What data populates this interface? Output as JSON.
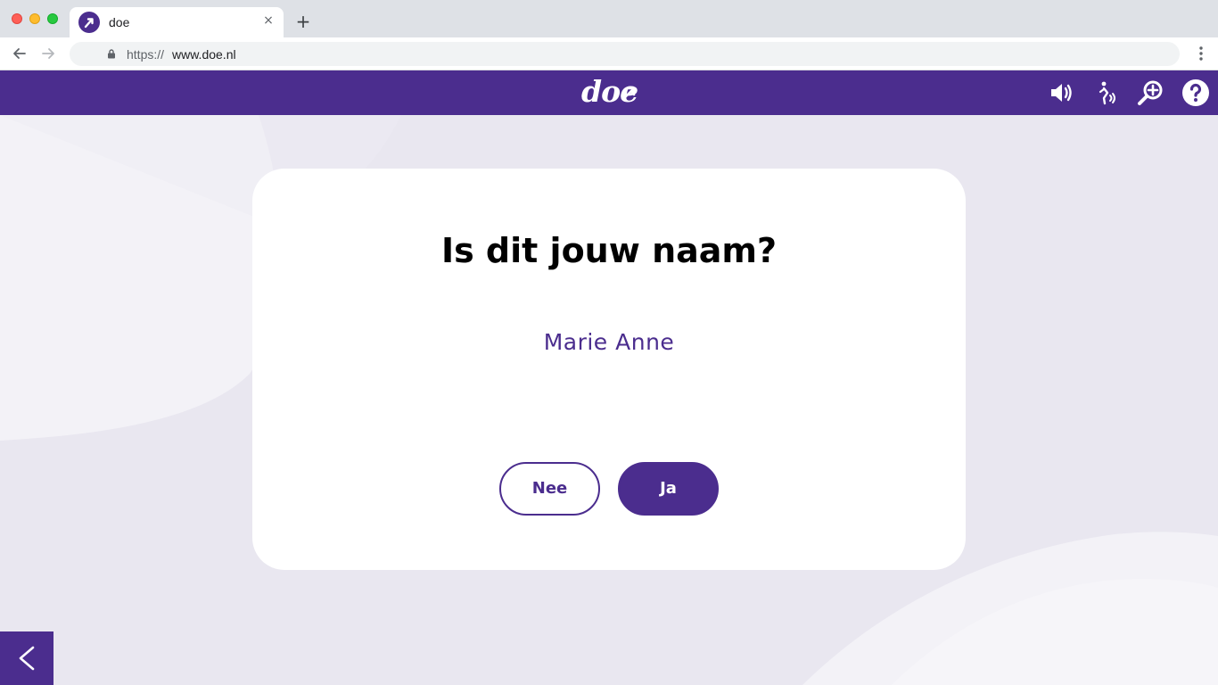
{
  "browser": {
    "tab_title": "doe",
    "new_tab_symbol": "+",
    "close_symbol": "×",
    "url_scheme": "https://",
    "url_host": "www.doe.nl"
  },
  "header": {
    "logo": "doe",
    "icons": [
      "speaker-icon",
      "sign-language-icon",
      "zoom-in-icon",
      "help-icon"
    ]
  },
  "card": {
    "question": "Is dit jouw naam?",
    "name": "Marie Anne",
    "no_label": "Nee",
    "yes_label": "Ja"
  },
  "colors": {
    "brand": "#4b2d8e",
    "background": "#e9e7f0",
    "card": "#ffffff"
  }
}
